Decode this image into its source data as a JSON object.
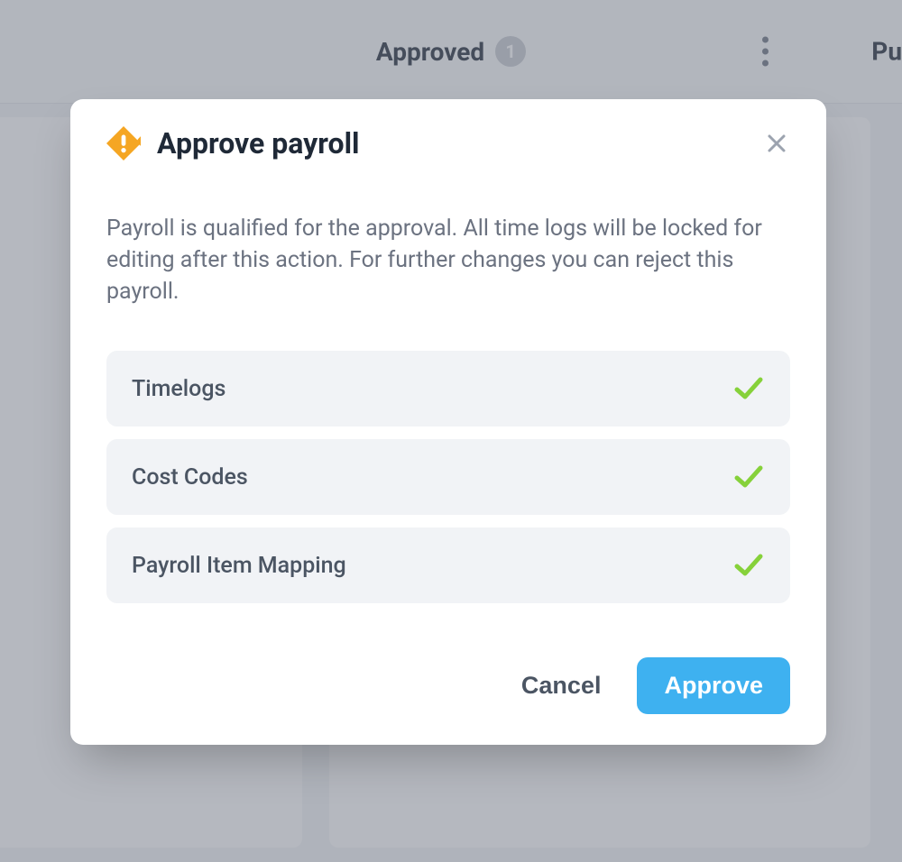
{
  "header": {
    "tab_label": "Approved",
    "badge_count": "1",
    "next_tab_partial": "Pu"
  },
  "modal": {
    "title": "Approve payroll",
    "description": "Payroll is qualified for the approval. All time logs will be locked for editing after this action. For further changes you can reject this payroll.",
    "checks": [
      {
        "label": "Timelogs"
      },
      {
        "label": "Cost Codes"
      },
      {
        "label": "Payroll Item Mapping"
      }
    ],
    "cancel_label": "Cancel",
    "approve_label": "Approve"
  },
  "colors": {
    "accent": "#3eb1f0",
    "warning": "#f5a623",
    "check_green": "#8bc34a"
  }
}
